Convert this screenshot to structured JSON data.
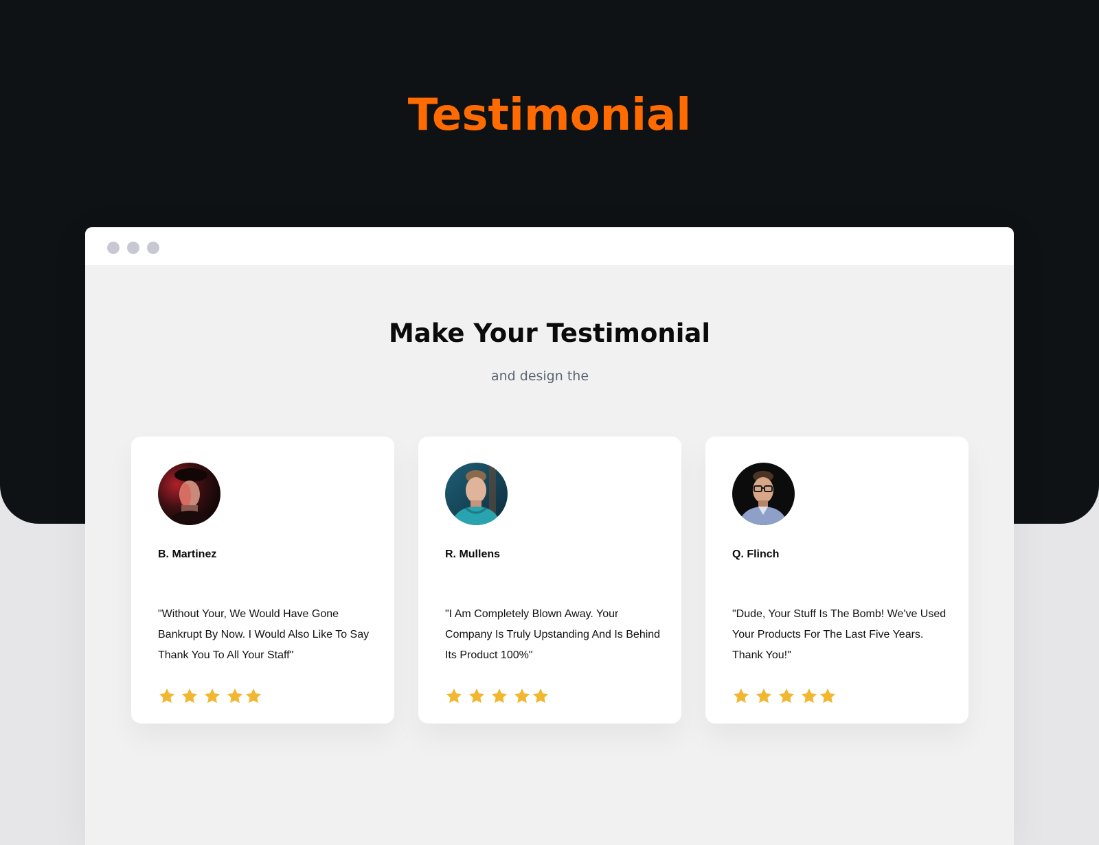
{
  "hero": {
    "title": "Testimonial"
  },
  "section": {
    "title": "Make Your Testimonial",
    "subtitle": "and design the"
  },
  "colors": {
    "accent": "#ff6b00",
    "dark_bg": "#0e1215",
    "star": "#f2b731",
    "window_dot": "#c8c8d2"
  },
  "testimonials": [
    {
      "name": "B. Martinez",
      "quote": "\"Without Your, We Would Have Gone Bankrupt By Now. I Would Also Like To Say Thank You To All Your Staff\"",
      "rating": 5
    },
    {
      "name": "R. Mullens",
      "quote": "\"I Am Completely Blown Away. Your Company Is Truly Upstanding And Is Behind Its Product 100%\"",
      "rating": 5
    },
    {
      "name": "Q. Flinch",
      "quote": "\"Dude, Your Stuff Is The Bomb! We've Used Your Products For The Last Five Years. Thank You!\"",
      "rating": 5
    }
  ]
}
